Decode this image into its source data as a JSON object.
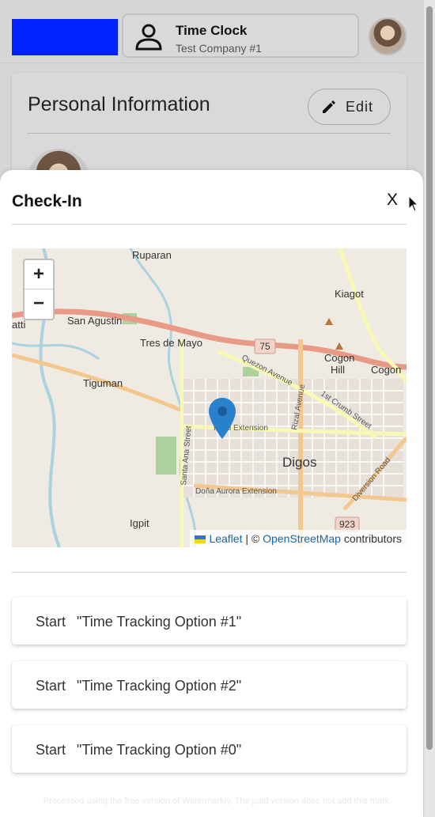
{
  "header": {
    "title": "Time Clock",
    "company": "Test Company #1",
    "brand_color": "#0022ff"
  },
  "profile_panel": {
    "title": "Personal Information",
    "edit_label": "Edit"
  },
  "checkin": {
    "title": "Check-In",
    "close_label": "X",
    "map": {
      "zoom_in": "+",
      "zoom_out": "−",
      "attribution": {
        "leaflet": "Leaflet",
        "separator": " | © ",
        "osm": "OpenStreetMap",
        "suffix": " contributors"
      },
      "places": [
        "Ruparan",
        "San Agustin",
        "Tres de Mayo",
        "Tiguman",
        "Kiagot",
        "Cogon Hill",
        "Cogon",
        "Digos",
        "Igpit"
      ],
      "roads": [
        "Quezon Avenue",
        "1st Crumb Street",
        "Rizal Avenue",
        "Rizal Extension",
        "Santa Ana Street",
        "Doña Aurora Extension",
        "Diversion Road"
      ],
      "shields": [
        "75",
        "923"
      ],
      "partial_label": "atti",
      "pin_color": "#2a81cb"
    },
    "options": [
      {
        "start": "Start",
        "name": "\"Time Tracking Option #1\""
      },
      {
        "start": "Start",
        "name": "\"Time Tracking Option #2\""
      },
      {
        "start": "Start",
        "name": "\"Time Tracking Option #0\""
      }
    ]
  },
  "footer_note": "Processed using the free version of Watermarkly. The paid version does not add this mark."
}
